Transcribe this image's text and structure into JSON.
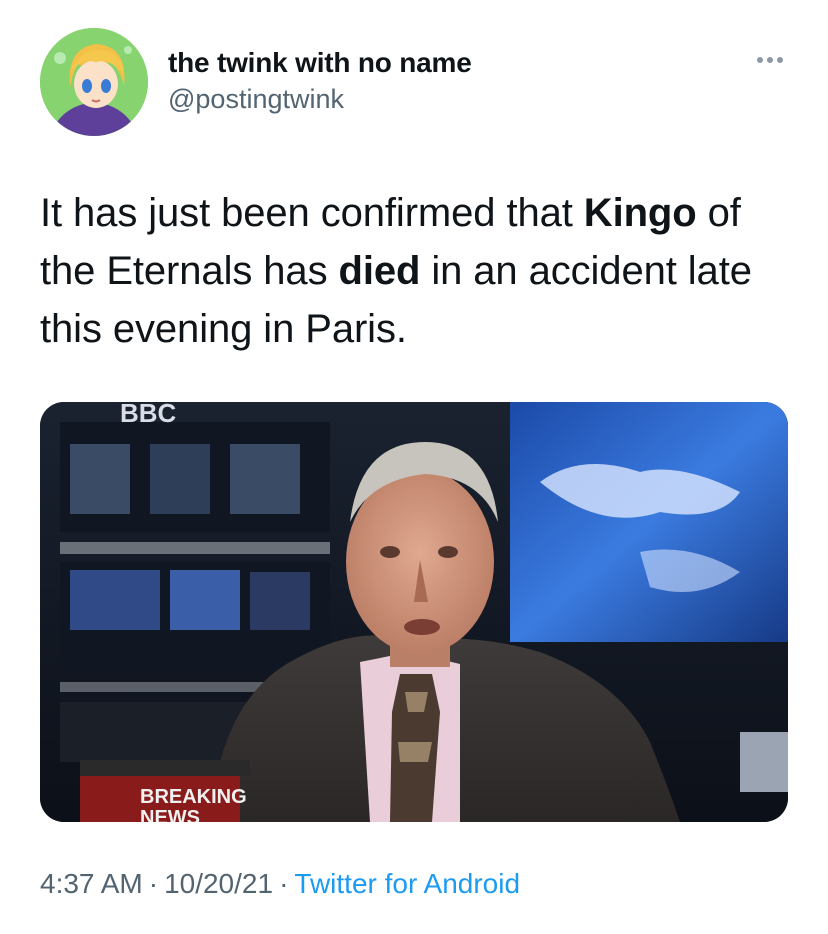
{
  "author": {
    "display_name": "the twink with no name",
    "handle": "@postingtwink"
  },
  "tweet": {
    "text_parts": [
      {
        "text": "It has just been confirmed that ",
        "bold": false
      },
      {
        "text": "Kingo",
        "bold": true
      },
      {
        "text": " of the Eternals has ",
        "bold": false
      },
      {
        "text": "died",
        "bold": true
      },
      {
        "text": " in an accident late this evening in Paris.",
        "bold": false
      }
    ]
  },
  "media": {
    "logo_text": "BBC",
    "banner_line1": "BREAKING",
    "banner_line2": "NEWS"
  },
  "meta": {
    "time": "4:37 AM",
    "date": "10/20/21",
    "source": "Twitter for Android",
    "separator": "·"
  },
  "icons": {
    "more": "more-options-icon"
  }
}
